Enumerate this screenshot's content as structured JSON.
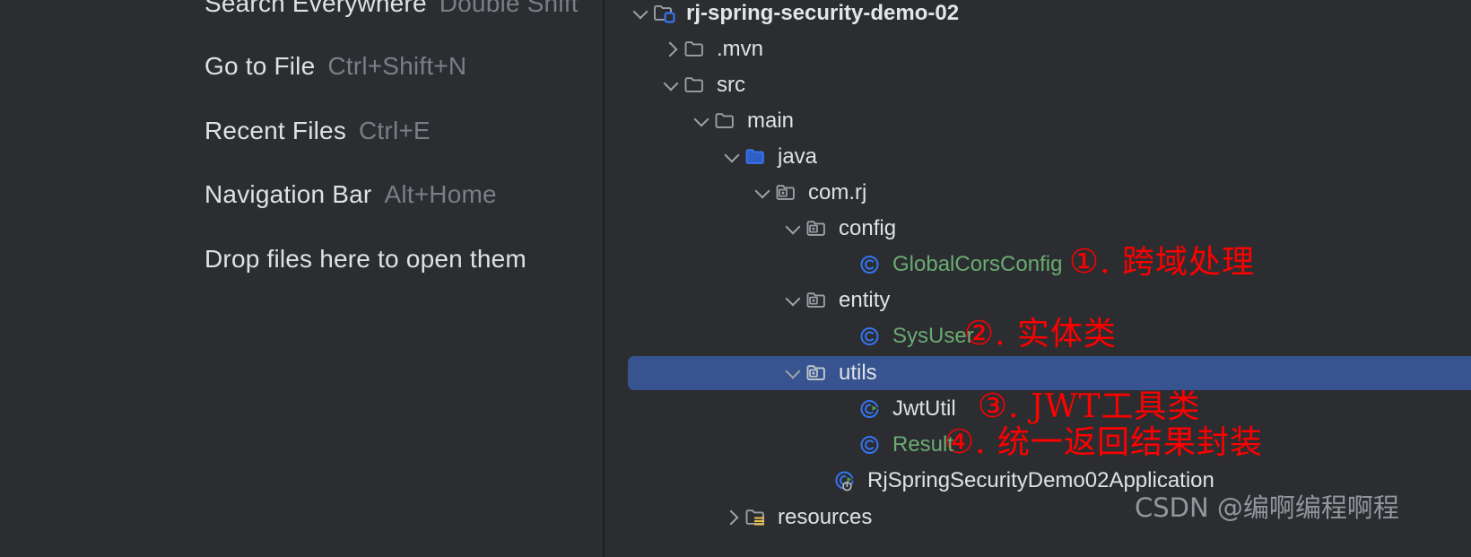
{
  "colors": {
    "background": "#2b2d30",
    "divider": "#1e1f22",
    "selection": "#375490",
    "text": "#dfe1e5",
    "shortcut_text": "#787f86",
    "class_green": "#6aab73",
    "icon_blue": "#3574f0",
    "annotation_red": "#ff0000",
    "watermark": "#9aa0a6",
    "folder_gray": "#9aa0a6",
    "source_root_blue": "#3574f0",
    "resources_yellow": "#e8bf4d",
    "run_green": "#59a869"
  },
  "editor_tips": {
    "rows": [
      {
        "label": "Search Everywhere",
        "shortcut": "Double Shift"
      },
      {
        "label": "Go to File",
        "shortcut": "Ctrl+Shift+N"
      },
      {
        "label": "Recent Files",
        "shortcut": "Ctrl+E"
      },
      {
        "label": "Navigation Bar",
        "shortcut": "Alt+Home"
      },
      {
        "label": "Drop files here to open them",
        "shortcut": ""
      }
    ]
  },
  "project_tree": {
    "nodes": [
      {
        "label": "rj-spring-security-demo-02",
        "icon": "module-folder-icon",
        "twisty": "down",
        "indent": 0,
        "style": "bold",
        "selected": false
      },
      {
        "label": ".mvn",
        "icon": "folder-icon",
        "twisty": "right",
        "indent": 1,
        "style": "plain",
        "selected": false
      },
      {
        "label": "src",
        "icon": "folder-icon",
        "twisty": "down",
        "indent": 1,
        "style": "plain",
        "selected": false
      },
      {
        "label": "main",
        "icon": "folder-icon",
        "twisty": "down",
        "indent": 2,
        "style": "plain",
        "selected": false
      },
      {
        "label": "java",
        "icon": "source-root-icon",
        "twisty": "down",
        "indent": 3,
        "style": "plain",
        "selected": false
      },
      {
        "label": "com.rj",
        "icon": "package-icon",
        "twisty": "down",
        "indent": 4,
        "style": "plain",
        "selected": false
      },
      {
        "label": "config",
        "icon": "package-icon",
        "twisty": "down",
        "indent": 5,
        "style": "plain",
        "selected": false
      },
      {
        "label": "GlobalCorsConfig",
        "icon": "class-icon",
        "twisty": "none",
        "indent": 6,
        "style": "green",
        "selected": false
      },
      {
        "label": "entity",
        "icon": "package-icon",
        "twisty": "down",
        "indent": 5,
        "style": "plain",
        "selected": false
      },
      {
        "label": "SysUser",
        "icon": "class-icon",
        "twisty": "none",
        "indent": 6,
        "style": "green",
        "selected": false
      },
      {
        "label": "utils",
        "icon": "package-icon",
        "twisty": "down",
        "indent": 5,
        "style": "plain",
        "selected": true
      },
      {
        "label": "JwtUtil",
        "icon": "runnable-class-icon",
        "twisty": "none",
        "indent": 6,
        "style": "plain",
        "selected": false
      },
      {
        "label": "Result",
        "icon": "class-icon",
        "twisty": "none",
        "indent": 6,
        "style": "green",
        "selected": false
      },
      {
        "label": "RjSpringSecurityDemo02Application",
        "icon": "spring-boot-class-icon",
        "twisty": "none",
        "indent": 5,
        "style": "plain",
        "selected": false
      },
      {
        "label": "resources",
        "icon": "resources-folder-icon",
        "twisty": "right",
        "indent": 3,
        "style": "plain",
        "selected": false
      }
    ]
  },
  "annotations": [
    {
      "number": "①",
      "text": ". 跨域处理"
    },
    {
      "number": "②",
      "text": ". 实体类"
    },
    {
      "number": "③",
      "text": ". JWT工具类"
    },
    {
      "number": "④",
      "text": ". 统一返回结果封装"
    }
  ],
  "watermark": {
    "text": "CSDN @编啊编程啊程"
  }
}
